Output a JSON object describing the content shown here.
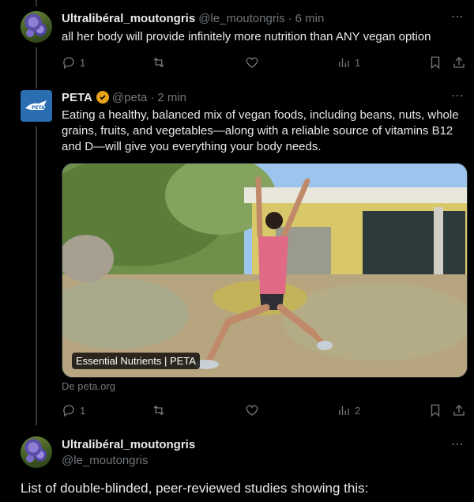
{
  "reply1": {
    "name": "Ultralibéral_moutongris",
    "handle": "@le_moutongris",
    "dot": "·",
    "time": "6 min",
    "text": "all her body will provide infinitely more nutrition than ANY vegan option",
    "reply_count": "1",
    "views_count": "1"
  },
  "peta_post": {
    "name": "PETA",
    "verified_icon": "gold-check-badge",
    "handle": "@peta",
    "dot": "·",
    "time": "2 min",
    "text": "Eating a healthy, balanced mix of vegan foods, including beans, nuts, whole grains, fruits, and vegetables—along with a reliable source of vitamins B12 and D—will give you everything your body needs.",
    "card_label": "Essential Nutrients | PETA",
    "card_source": "De peta.org",
    "reply_count": "1",
    "views_count": "2",
    "avatar_text": "PETA"
  },
  "reply2": {
    "name": "Ultralibéral_moutongris",
    "handle": "@le_moutongris",
    "text": "List of double-blinded, peer-reviewed studies showing this:"
  },
  "icons": {
    "more": "⋯",
    "reply": "reply-icon",
    "retweet": "retweet-icon",
    "like": "heart-icon",
    "views": "views-icon",
    "bookmark": "bookmark-icon",
    "share": "share-icon"
  },
  "colors": {
    "background": "#000000",
    "text": "#e7e9ea",
    "muted": "#71767b",
    "verified": "#e8a217",
    "thread_line": "#333639"
  }
}
